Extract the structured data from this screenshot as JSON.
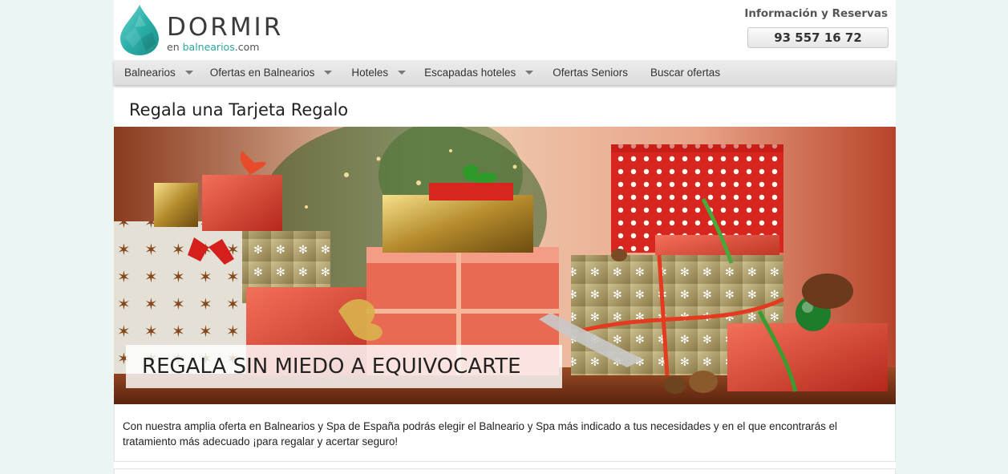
{
  "brand": {
    "name": "DORMIR",
    "subtitle_prefix": "en ",
    "subtitle_domain": "balnearios",
    "subtitle_suffix": ".com"
  },
  "contact": {
    "title": "Información y Reservas",
    "phone": "93 557 16 72"
  },
  "nav": {
    "items": [
      {
        "label": "Balnearios",
        "has_dropdown": true
      },
      {
        "label": "Ofertas en Balnearios",
        "has_dropdown": true
      },
      {
        "label": "Hoteles",
        "has_dropdown": true
      },
      {
        "label": "Escapadas hoteles",
        "has_dropdown": true
      },
      {
        "label": "Ofertas Seniors",
        "has_dropdown": false
      },
      {
        "label": "Buscar ofertas",
        "has_dropdown": false
      }
    ]
  },
  "main": {
    "title": "Regala una Tarjeta Regalo",
    "banner_caption": "REGALA SIN MIEDO A EQUIVOCARTE",
    "description": "Con nuestra amplia oferta en Balnearios y Spa de España podrás elegir el Balneario y Spa más indicado a tus necesidades y en el que encontrarás el tratamiento más adecuado ¡para regalar y acertar seguro!"
  },
  "colors": {
    "background": "#eaf5f4",
    "brand_teal": "#2ab8b0",
    "nav_bg": "#e3e3e3"
  }
}
